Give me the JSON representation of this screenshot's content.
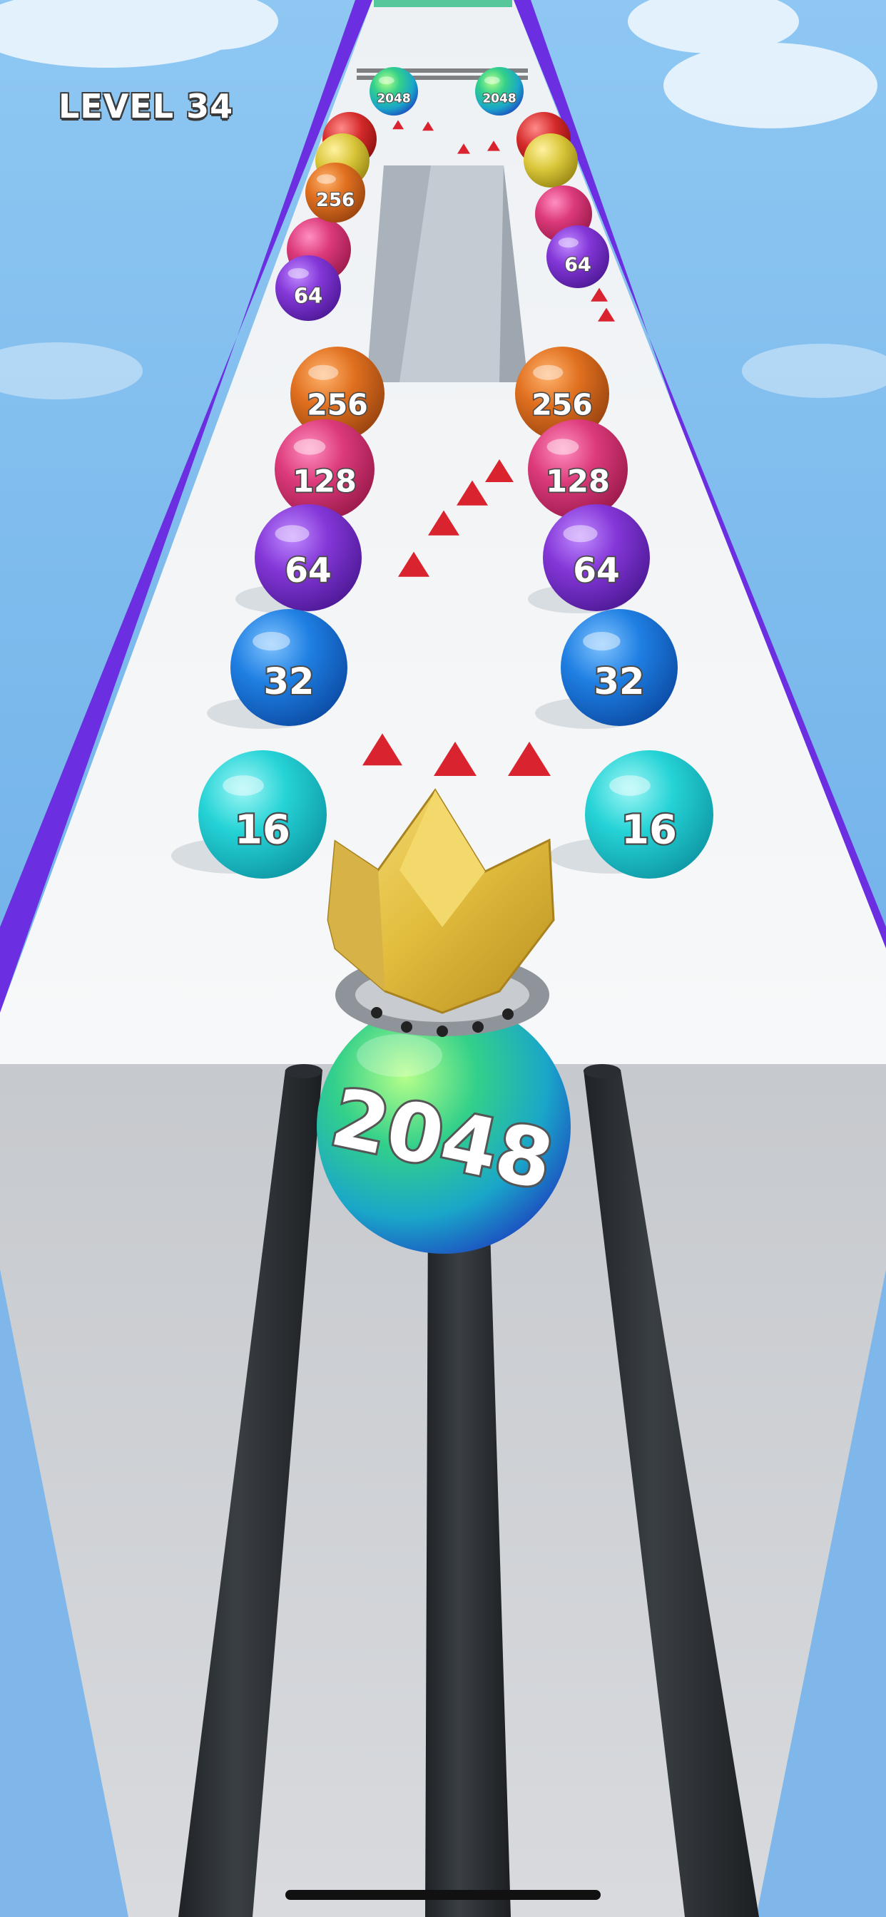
{
  "hud": {
    "level_label": "LEVEL 34"
  },
  "player_ball": {
    "value": "2048",
    "accessory": "crown"
  },
  "balls": [
    {
      "value": "2048",
      "color": "#3fb86a"
    },
    {
      "value": "2048",
      "color": "#3fb86a"
    },
    {
      "value": "256",
      "color": "#d7641d"
    },
    {
      "value": "64",
      "color": "#7a32c8"
    },
    {
      "value": "64",
      "color": "#7a32c8"
    },
    {
      "value": "256",
      "color": "#d7641d"
    },
    {
      "value": "256",
      "color": "#d7641d"
    },
    {
      "value": "128",
      "color": "#cc2f6b"
    },
    {
      "value": "128",
      "color": "#cc2f6b"
    },
    {
      "value": "64",
      "color": "#7a32c8"
    },
    {
      "value": "64",
      "color": "#7a32c8"
    },
    {
      "value": "32",
      "color": "#1a6fd6"
    },
    {
      "value": "32",
      "color": "#1a6fd6"
    },
    {
      "value": "16",
      "color": "#1fc9cf"
    },
    {
      "value": "16",
      "color": "#1fc9cf"
    }
  ],
  "colors": {
    "sky": "#6fb2ea",
    "track": "#f2f4f6",
    "rail": "#6b2ee0",
    "spike": "#d9232f",
    "bars": "#2b2f33"
  }
}
